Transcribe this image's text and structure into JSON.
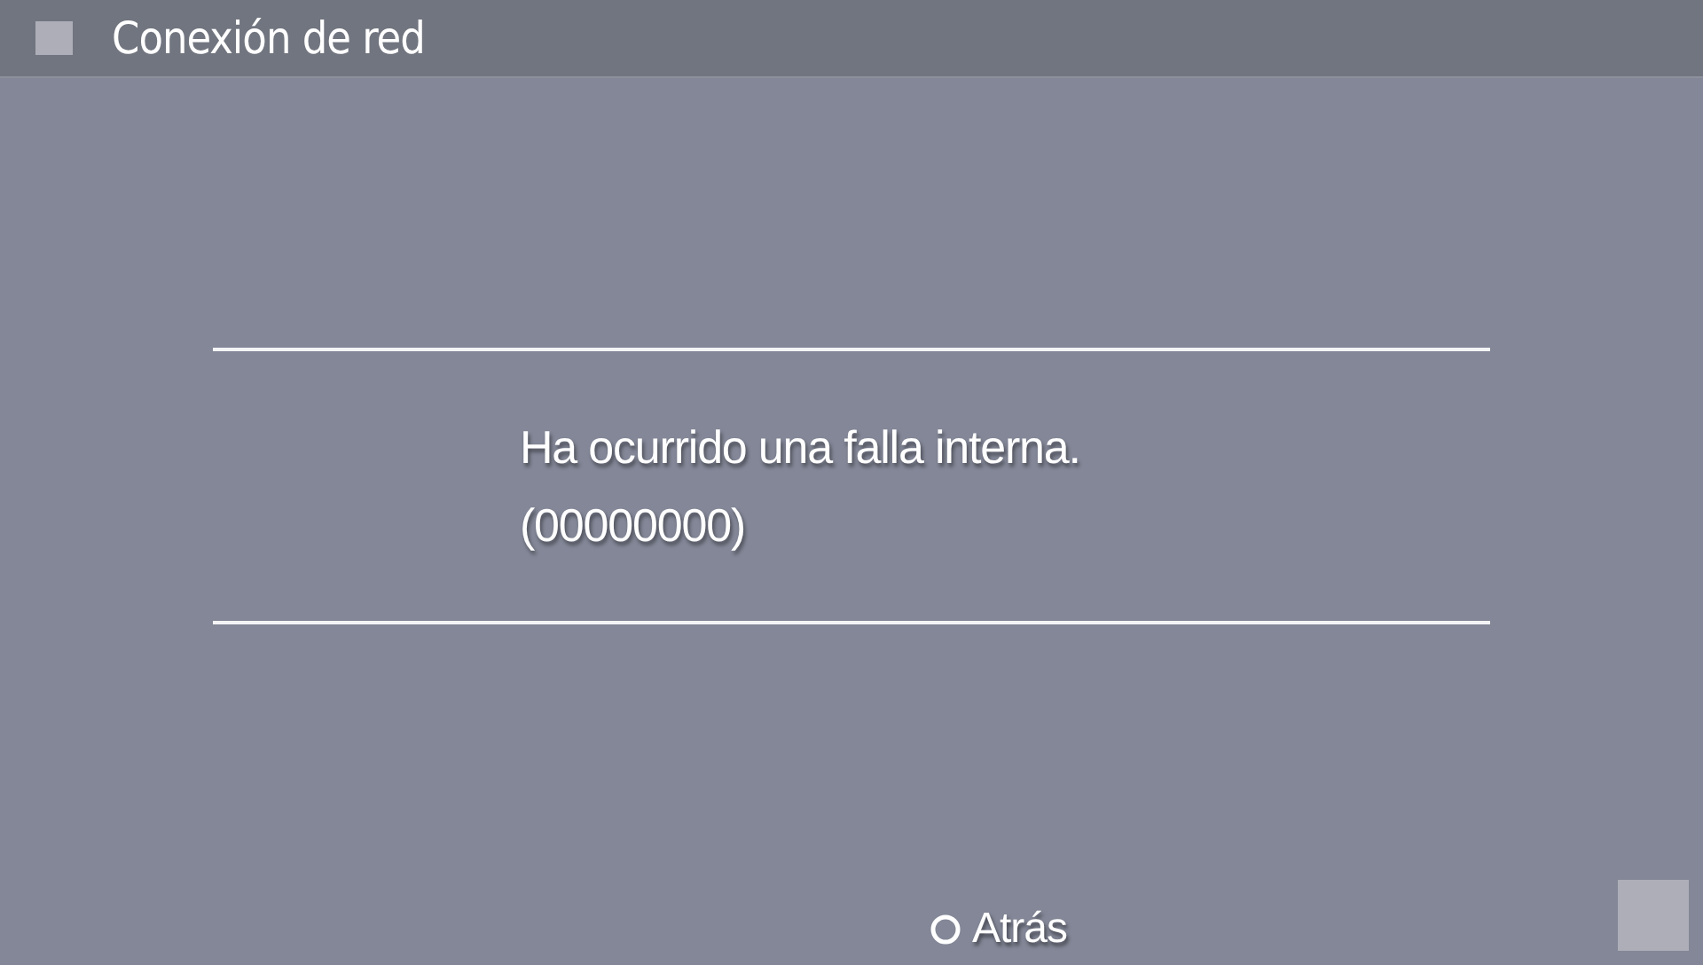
{
  "window": {
    "title": "Conexión de red"
  },
  "message": {
    "lines": [
      "Ha ocurrido una falla interna.",
      "(00000000)"
    ]
  },
  "buttons": [
    {
      "label": "Atrás"
    }
  ]
}
